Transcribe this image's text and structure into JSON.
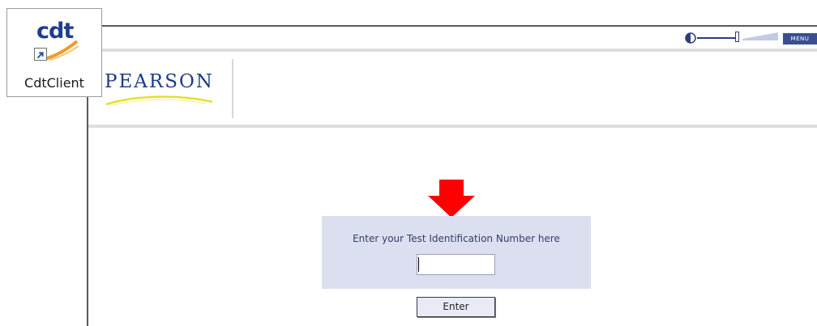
{
  "desktop_shortcut": {
    "logo_text": "cdt",
    "label": "CdtClient"
  },
  "toolbar": {
    "volume_icon": "speaker-icon",
    "menu_label": "MENU"
  },
  "header": {
    "logo_text": "PEARSON"
  },
  "login": {
    "prompt": "Enter your Test Identification Number here",
    "test_id_value": "",
    "enter_label": "Enter"
  },
  "colors": {
    "brand_blue": "#1b3a8c",
    "panel_bg": "#dcdff0",
    "pointer_red": "#ff0000",
    "menu_bg": "#3a4f8f"
  }
}
